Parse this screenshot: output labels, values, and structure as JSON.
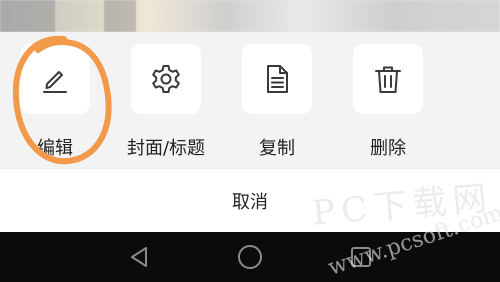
{
  "actions": [
    {
      "label": "编辑",
      "icon": "edit-pencil-icon"
    },
    {
      "label": "封面/标题",
      "icon": "gear-icon"
    },
    {
      "label": "复制",
      "icon": "document-icon"
    },
    {
      "label": "删除",
      "icon": "trash-icon"
    }
  ],
  "cancel_label": "取消",
  "navigation": {
    "back_icon": "back-triangle-icon",
    "home_icon": "home-circle-icon",
    "recents_icon": "recents-square-icon"
  },
  "watermark": {
    "main": "PC下载网",
    "sub": "www.pcsoft.com.cn"
  },
  "colors": {
    "sheet_bg": "#f3f3f3",
    "icon_box_bg": "#ffffff",
    "navbar_bg": "#0b0b0b",
    "highlight": "#f2994a"
  }
}
